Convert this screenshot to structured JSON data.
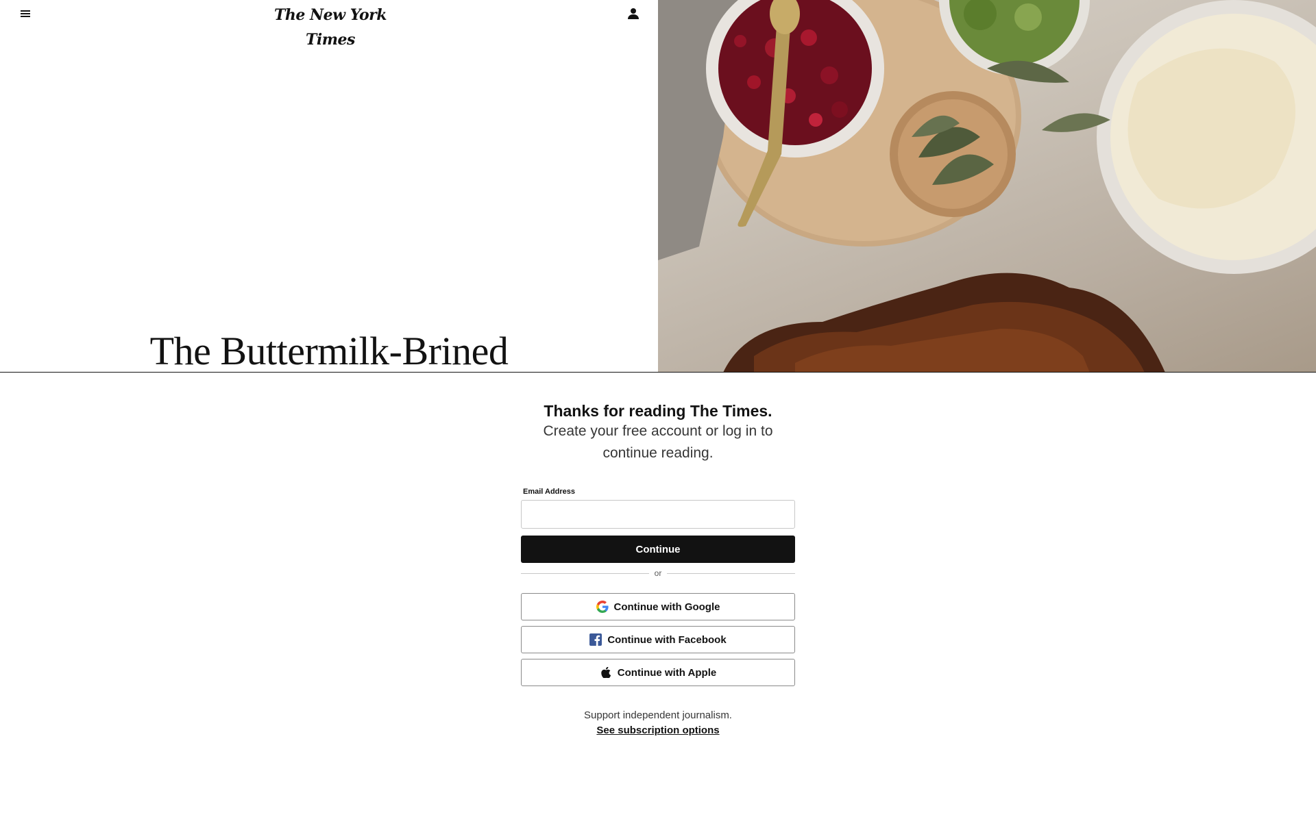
{
  "header": {
    "menu_icon": "hamburger-menu-icon",
    "logo_text": "The New York Times",
    "account_icon": "person-icon"
  },
  "article": {
    "headline": "The Buttermilk-Brined",
    "photo_icon": "food-photo"
  },
  "registration": {
    "title": "Thanks for reading The Times.",
    "subtitle": "Create your free account or log in to continue reading.",
    "email_label": "Email Address",
    "email_value": "",
    "continue_label": "Continue",
    "or_label": "or",
    "google_label": "Continue with Google",
    "facebook_label": "Continue with Facebook",
    "apple_label": "Continue with Apple",
    "support_text": "Support independent journalism.",
    "subscription_link": "See subscription options"
  },
  "colors": {
    "ink": "#121212",
    "border": "#c7c7c7",
    "facebook_blue": "#3b5998"
  }
}
